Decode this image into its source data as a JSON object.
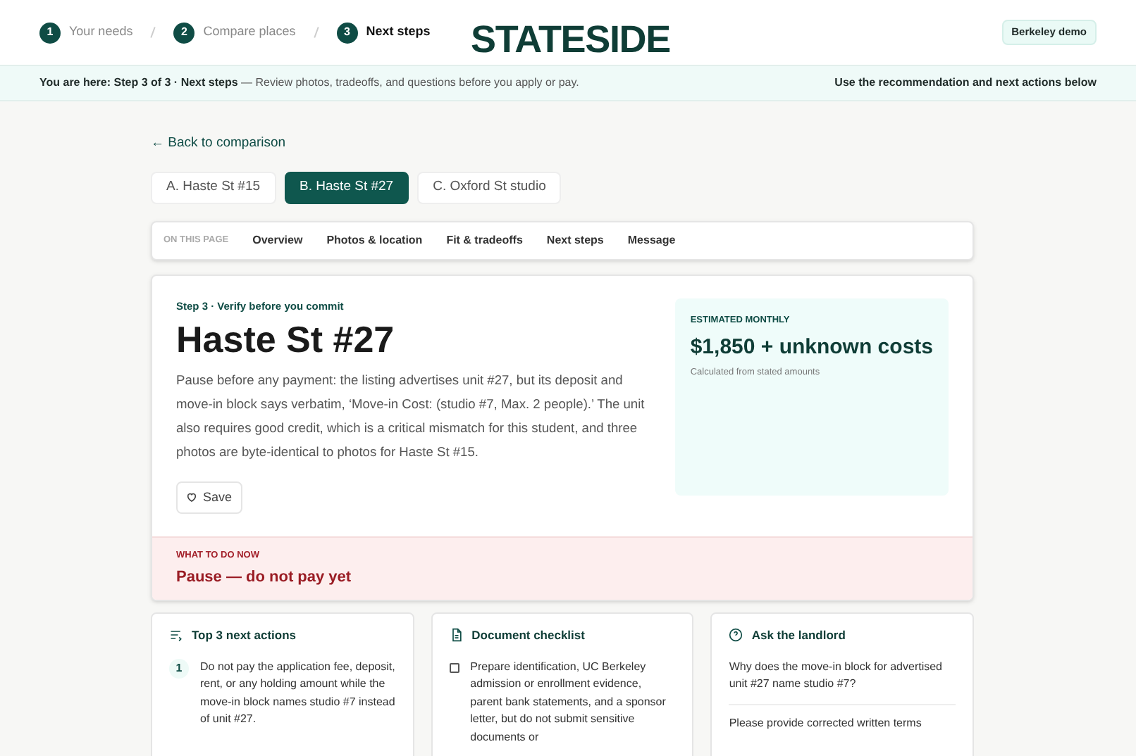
{
  "steps": [
    {
      "number": "1",
      "label": "Your needs",
      "selected": false
    },
    {
      "number": "2",
      "label": "Compare places",
      "selected": false
    },
    {
      "number": "3",
      "label": "Next steps",
      "selected": true
    }
  ],
  "logo": "STATESIDE",
  "demo_badge": "Berkeley demo",
  "banner": {
    "lead": "You are here: Step 3 of 3 · Next steps",
    "text": "— Review photos, tradeoffs, and questions before you apply or pay.",
    "right": "Use the recommendation and next actions below"
  },
  "back_link": "← Back to comparison",
  "options": [
    {
      "label": "A. Haste St #15",
      "selected": false
    },
    {
      "label": "B. Haste St #27",
      "selected": true
    },
    {
      "label": "C. Oxford St studio",
      "selected": false
    }
  ],
  "on_this_page": {
    "label": "ON THIS PAGE",
    "links": [
      "Overview",
      "Photos & location",
      "Fit & tradeoffs",
      "Next steps",
      "Message"
    ]
  },
  "overview": {
    "eyebrow": "Step 3 · Verify before you commit",
    "title": "Haste St #27",
    "summary": "Pause before any payment: the listing advertises unit #27, but its deposit and move-in block says verbatim, ‘Move-in Cost: (studio #7, Max. 2 people).’ The unit also requires good credit, which is a critical mismatch for this student, and three photos are byte-identical to photos for Haste St #15.",
    "save": "Save",
    "estimate": {
      "label": "ESTIMATED MONTHLY",
      "amount": "$1,850 + unknown costs",
      "note": "Calculated from stated amounts"
    },
    "todo": {
      "label": "WHAT TO DO NOW",
      "text": "Pause — do not pay yet"
    }
  },
  "actions": {
    "title": "Top 3 next actions",
    "items": [
      {
        "number": "1",
        "text": "Do not pay the application fee, deposit, rent, or any holding amount while the move-in block names studio #7 instead of unit #27."
      }
    ]
  },
  "checklist": {
    "title": "Document checklist",
    "items": [
      {
        "text": "Prepare identification, UC Berkeley admission or enrollment evidence, parent bank statements, and a sponsor letter, but do not submit sensitive documents or",
        "checked": false
      }
    ]
  },
  "landlord": {
    "title": "Ask the landlord",
    "questions": [
      "Why does the move-in block for advertised unit #27 name studio #7?",
      "Please provide corrected written terms"
    ]
  }
}
